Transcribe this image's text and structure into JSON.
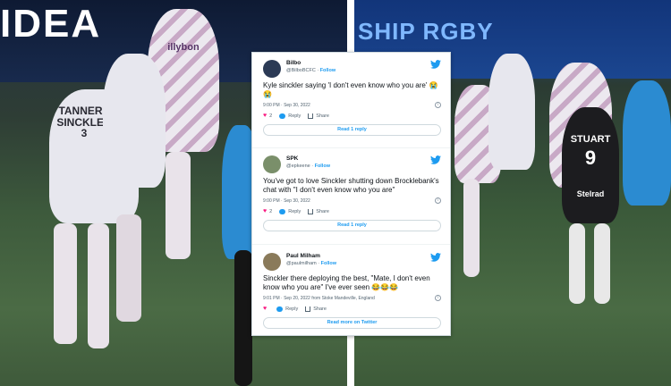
{
  "background": {
    "left_banner_text": "IDEA",
    "right_banner_text": "SHIP RGBY",
    "left_shirt_text": "TANNERS SINCKLER 3",
    "left_shirt_sponsor": "illybon",
    "referee_name": "STUART",
    "referee_number": "9",
    "referee_sponsor": "Stelrad"
  },
  "tweets": [
    {
      "name": "Bilbo",
      "handle": "@BilboBCFC",
      "follow": "Follow",
      "text": "Kyle sinckler saying 'I don't even know who you are' 😭😭",
      "time": "9:00 PM · Sep 30, 2022",
      "likes": "2",
      "reply": "Reply",
      "share": "Share",
      "cta": "Read 1 reply",
      "avatar_color": "#2b3a55"
    },
    {
      "name": "SPK",
      "handle": "@epkeene",
      "follow": "Follow",
      "text": "You've got to love Sinckler shutting down Brocklebank's chat with \"I don't even know who you are\"",
      "time": "9:00 PM · Sep 30, 2022",
      "likes": "2",
      "reply": "Reply",
      "share": "Share",
      "cta": "Read 1 reply",
      "avatar_color": "#7a8f6a"
    },
    {
      "name": "Paul Milham",
      "handle": "@paulmilham",
      "follow": "Follow",
      "text": "Sinckler there deploying the best, \"Mate, I don't even know who you are\" I've ever seen 😂😂😂",
      "time": "9:01 PM · Sep 20, 2022 from Stoke Mandeville, England",
      "likes": "",
      "reply": "Reply",
      "share": "Share",
      "cta": "Read more on Twitter",
      "avatar_color": "#8a7a5a"
    }
  ],
  "colors": {
    "twitter_blue": "#1d9bf0",
    "like_pink": "#f91880",
    "text_dark": "#0f1419",
    "text_muted": "#536471"
  }
}
